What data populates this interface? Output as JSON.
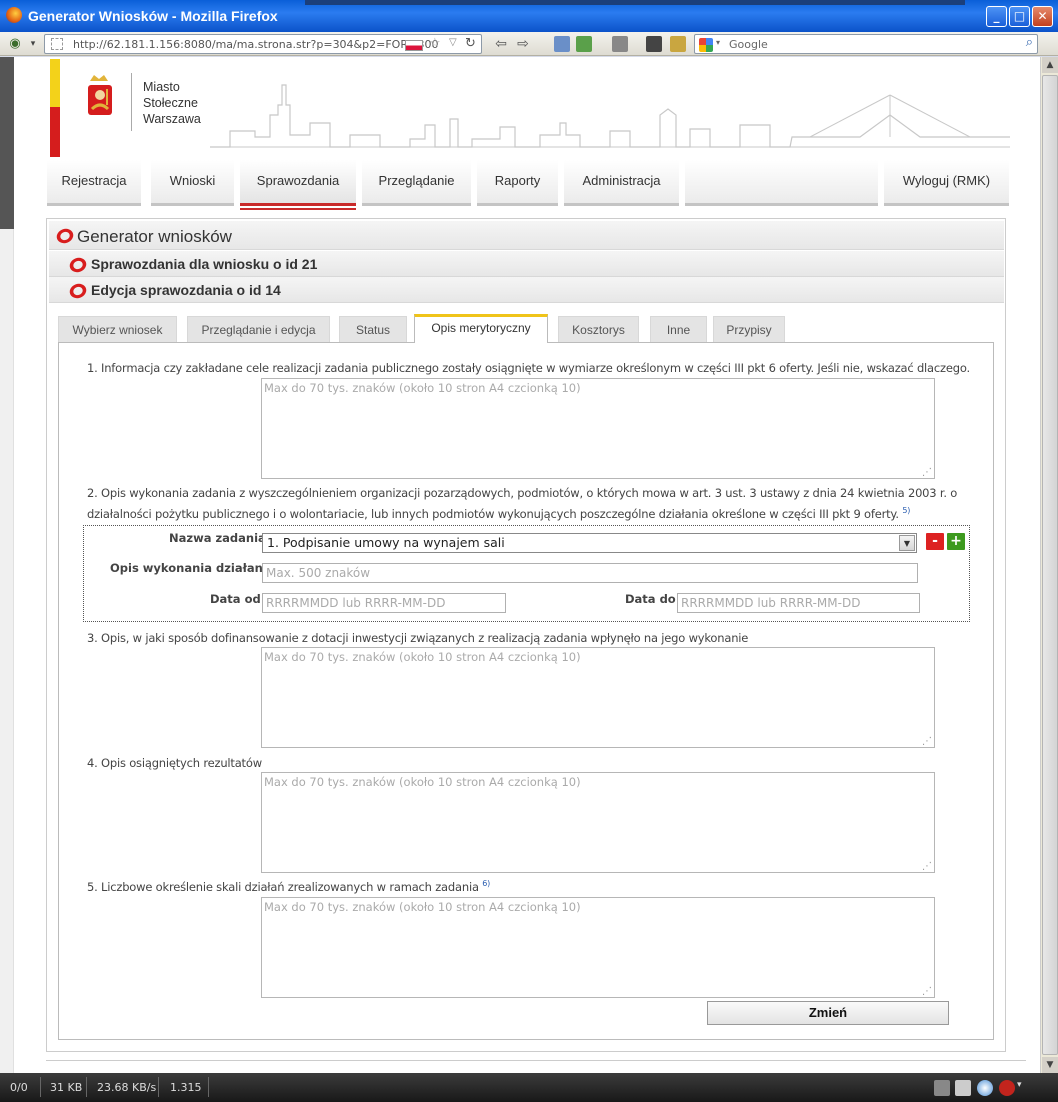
{
  "window": {
    "title": "Generator Wniosków - Mozilla Firefox"
  },
  "browser": {
    "url": "http://62.181.1.156:8080/ma/ma.strona.str?p=304&p2=FORM300",
    "search_placeholder": "Google"
  },
  "header": {
    "brand_text": "Miasto\nStołeczne\nWarszawa"
  },
  "mainnav": {
    "items": [
      {
        "label": "Rejestracja"
      },
      {
        "label": "Wnioski"
      },
      {
        "label": "Sprawozdania",
        "active": true
      },
      {
        "label": "Przeglądanie"
      },
      {
        "label": "Raporty"
      },
      {
        "label": "Administracja"
      },
      {
        "label": ""
      },
      {
        "label": "Wyloguj (RMK)"
      }
    ]
  },
  "panel": {
    "title": "Generator wniosków",
    "subtitle1": "Sprawozdania dla wniosku o id 21",
    "subtitle2": "Edycja sprawozdania o id 14"
  },
  "tabs": [
    {
      "label": "Wybierz wniosek"
    },
    {
      "label": "Przeglądanie i edycja"
    },
    {
      "label": "Status"
    },
    {
      "label": "Opis merytoryczny",
      "active": true
    },
    {
      "label": "Kosztorys"
    },
    {
      "label": "Inne"
    },
    {
      "label": "Przypisy"
    }
  ],
  "form": {
    "q1": "1. Informacja czy zakładane cele realizacji zadania publicznego zostały osiągnięte w wymiarze określonym w części III pkt 6 oferty. Jeśli nie, wskazać dlaczego.",
    "q2": "2. Opis wykonania zadania z wyszczególnieniem organizacji pozarządowych, podmiotów, o których mowa w art. 3 ust. 3 ustawy z dnia 24 kwietnia 2003 r. o działalności pożytku publicznego i o wolontariacie, lub innych podmiotów wykonujących poszczególne działania określone w części III pkt 9 oferty.",
    "q2_footnote": "5)",
    "q3": "3. Opis, w jaki sposób dofinansowanie z dotacji inwestycji związanych z realizacją zadania wpłynęło na jego wykonanie",
    "q4": "4. Opis osiągniętych rezultatów",
    "q5": "5. Liczbowe określenie skali działań zrealizowanych w ramach zadania",
    "q5_footnote": "6)",
    "textarea_placeholder": "Max do 70 tys. znaków (około 10 stron A4 czcionką 10)",
    "task": {
      "name_label": "Nazwa zadania",
      "name_value": "1. Podpisanie umowy na wynajem sali",
      "desc_label": "Opis wykonania działania",
      "desc_placeholder": "Max. 500 znaków",
      "date_from_label": "Data od",
      "date_to_label": "Data do",
      "date_placeholder": "RRRRMMDD lub RRRR-MM-DD",
      "remove_label": "-",
      "add_label": "+"
    },
    "submit_label": "Zmień"
  },
  "statusbar": {
    "c1": "0/0",
    "c2": "31 KB",
    "c3": "23.68 KB/s",
    "c4": "1.315"
  }
}
